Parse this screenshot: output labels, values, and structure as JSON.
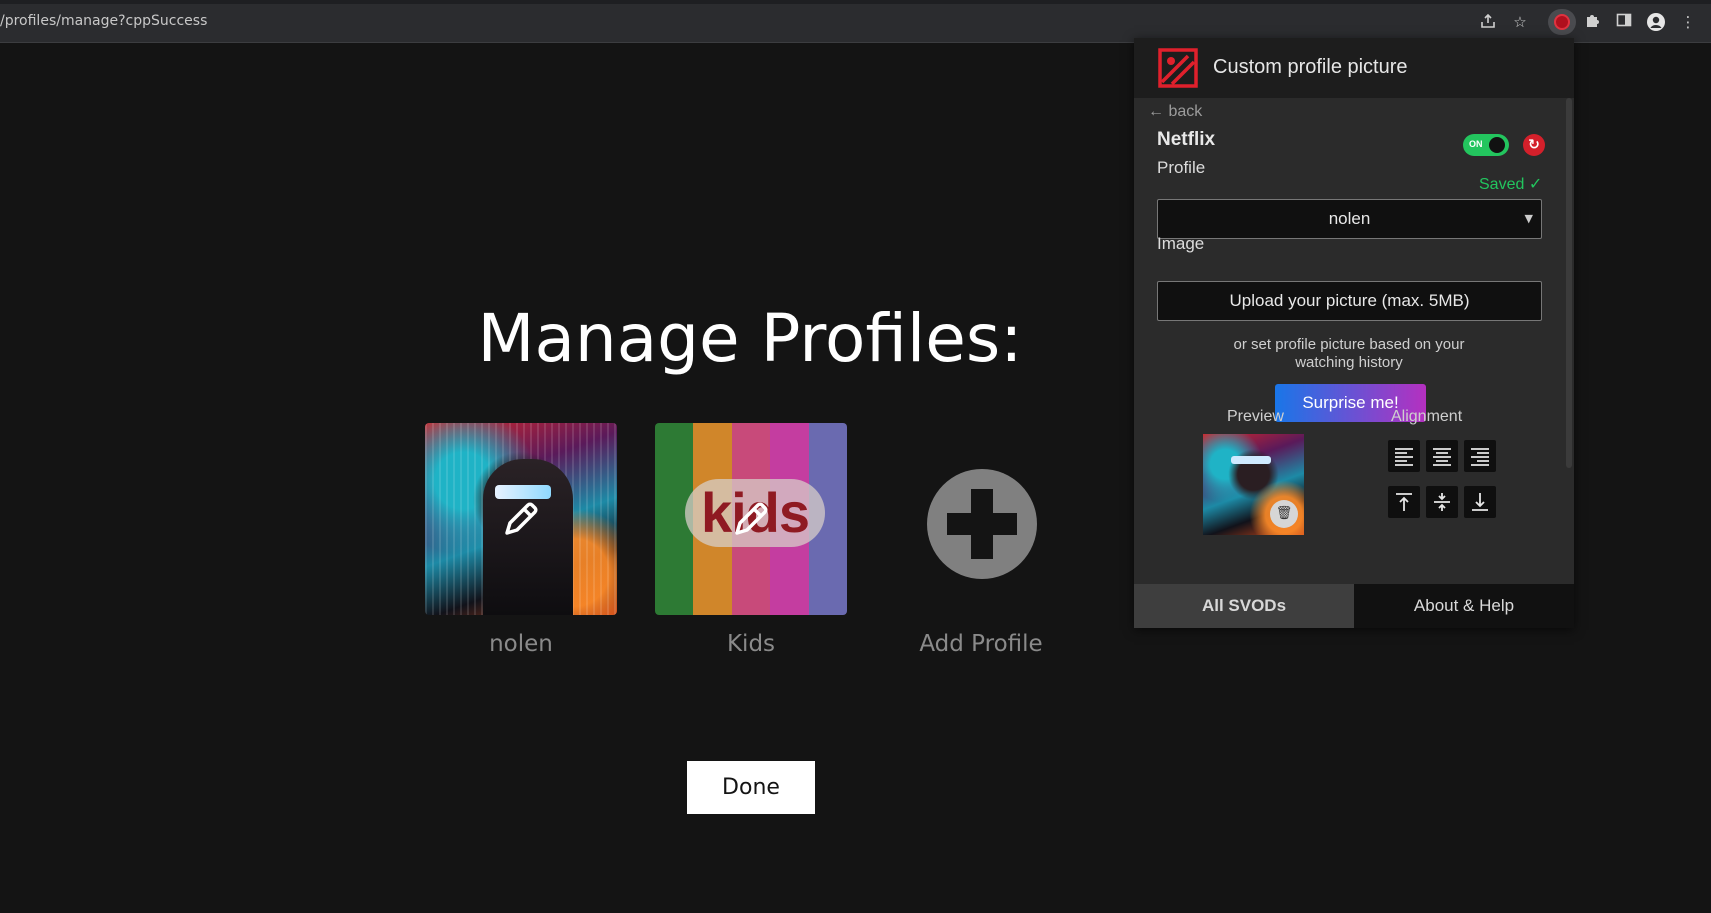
{
  "browser": {
    "url": "/profiles/manage?cppSuccess"
  },
  "main": {
    "title": "Manage Profiles:",
    "profiles": [
      {
        "name": "nolen"
      },
      {
        "name": "Kids",
        "art_text": "kids"
      }
    ],
    "add_profile_label": "Add Profile",
    "done_label": "Done"
  },
  "popup": {
    "title": "Custom profile picture",
    "back_label": "← back",
    "service_name": "Netflix",
    "toggle_label": "ON",
    "profile_label": "Profile",
    "saved_status": "Saved ✓",
    "selected_profile": "nolen",
    "image_label": "Image",
    "upload_label": "Upload your picture (max. 5MB)",
    "or_text_line1": "or set profile picture based on your",
    "or_text_line2": "watching history",
    "surprise_label": "Surprise me!",
    "preview_label": "Preview",
    "alignment_label": "Alignment",
    "tabs": [
      {
        "label": "All SVODs"
      },
      {
        "label": "About & Help"
      }
    ]
  },
  "colors": {
    "background": "#141414",
    "accent_red": "#d4202b",
    "toggle_green": "#23c55e",
    "saved_green": "#22c55e"
  }
}
